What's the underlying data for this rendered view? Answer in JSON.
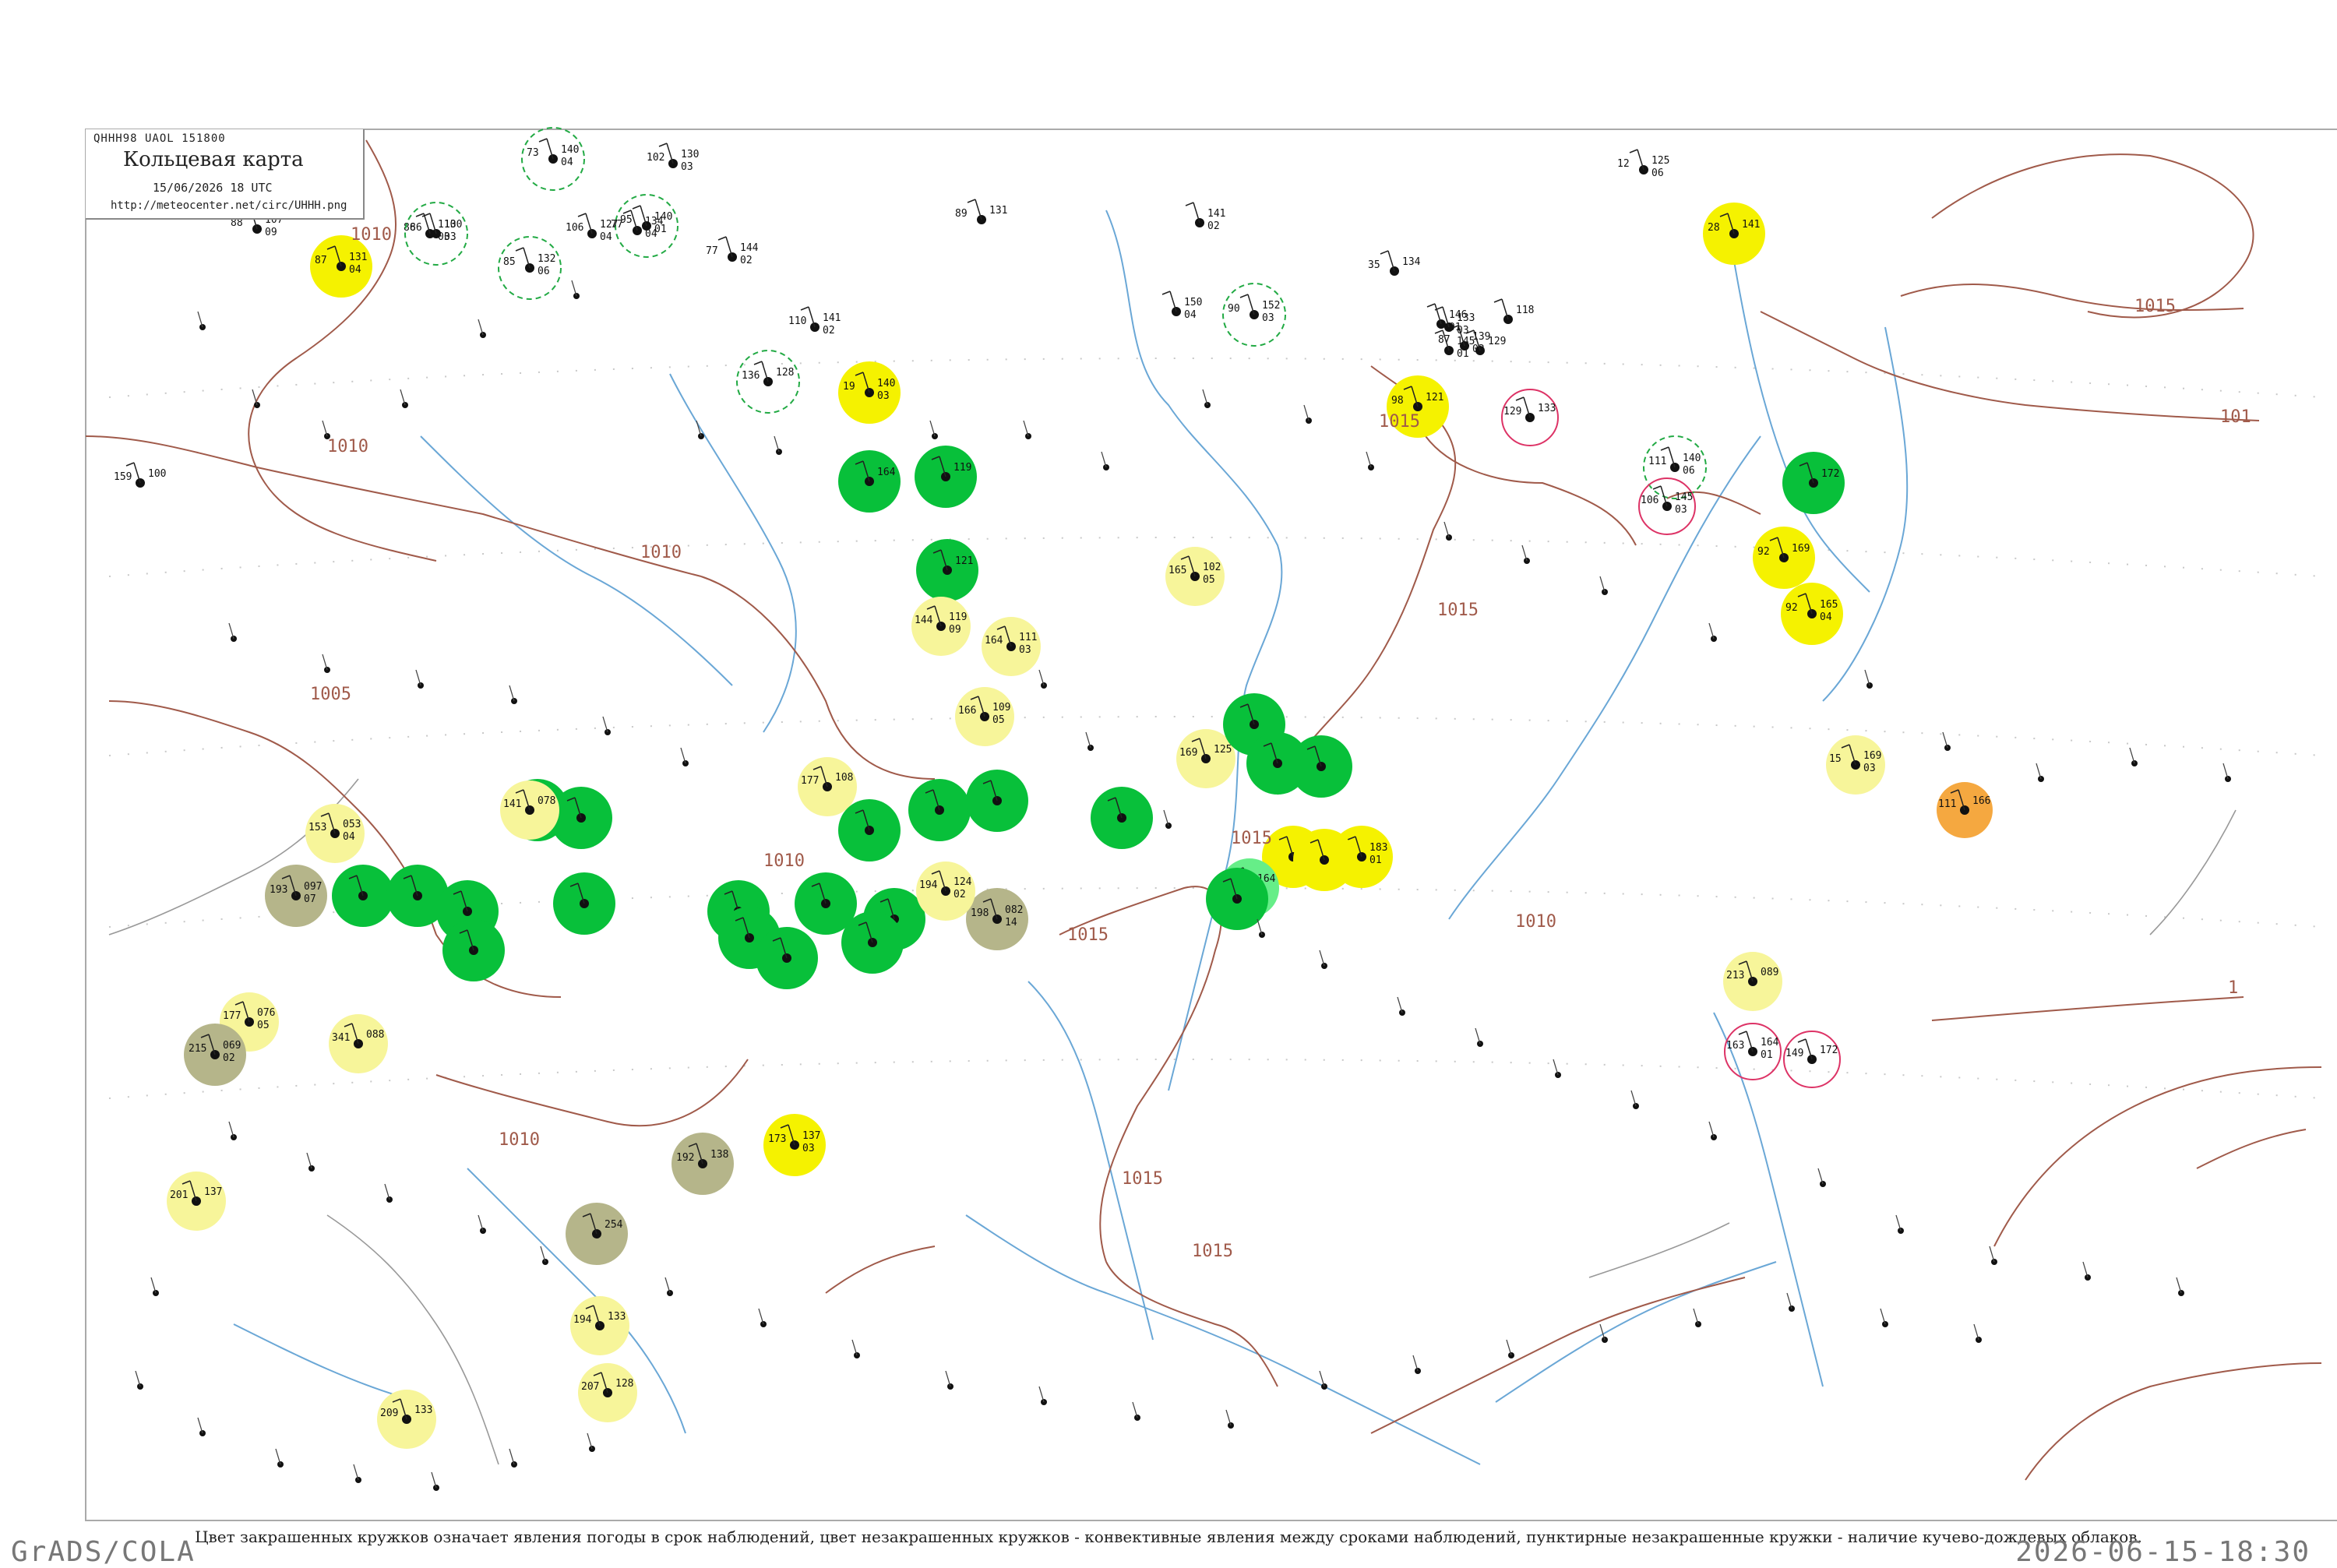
{
  "header": {
    "code_line": "QHHH98  UAOL  151800",
    "title": "Кольцевая карта",
    "date_line": "15/06/2026 18 UTC",
    "url": "http://meteocenter.net/circ/UHHH.png"
  },
  "caption": "Цвет закрашенных кружков означает явления погоды в срок наблюдений, цвет незакрашенных кружков - конвективные явления между сроками наблюдений, пунктирные незакрашенные кружки - наличие кучево-дождевых облаков.",
  "footer": {
    "left": "GrADS/COLA",
    "right": "2026-06-15-18:30"
  },
  "colors": {
    "isobar": "#a05a4a",
    "river": "#6aa7d6",
    "border": "#999999",
    "green": "#08c03a",
    "light_green": "#66ee88",
    "yellow": "#f5f200",
    "light_yellow": "#f7f59a",
    "olive": "#b5b58a",
    "orange": "#f5a840",
    "ring_green": "#22aa44",
    "ring_red": "#dd3366"
  },
  "isobar_labels": [
    {
      "text": "1010"
    },
    {
      "text": "1010"
    },
    {
      "text": "1010"
    },
    {
      "text": "1005"
    },
    {
      "text": "1010"
    },
    {
      "text": "1010"
    },
    {
      "text": "1015"
    },
    {
      "text": "1015"
    },
    {
      "text": "1015"
    },
    {
      "text": "1015"
    },
    {
      "text": "1015"
    },
    {
      "text": "1015"
    },
    {
      "text": "1010"
    },
    {
      "text": "1015"
    },
    {
      "text": "101"
    },
    {
      "text": "1"
    }
  ],
  "stations": [
    {
      "t": "131",
      "p": "04",
      "d": "87",
      "c": "yellow"
    },
    {
      "t": "107",
      "p": "09",
      "d": "88",
      "c": "none"
    },
    {
      "t": "110",
      "p": "03",
      "d": "86",
      "c": "none"
    },
    {
      "t": "140",
      "p": "04",
      "d": "73",
      "c": "ring_green"
    },
    {
      "t": "130",
      "p": "03",
      "d": "102",
      "c": "none"
    },
    {
      "t": "134",
      "p": "04",
      "d": "77",
      "c": "none"
    },
    {
      "t": "140",
      "p": "01",
      "d": "95",
      "c": "ring_green"
    },
    {
      "t": "132",
      "p": "06",
      "d": "85",
      "c": "ring_green"
    },
    {
      "t": "127",
      "p": "04",
      "d": "106",
      "c": "none"
    },
    {
      "t": "130",
      "p": "03",
      "d": "86",
      "c": "ring_green"
    },
    {
      "t": "144",
      "p": "02",
      "d": "77",
      "c": "none"
    },
    {
      "t": "131",
      "p": "",
      "d": "89",
      "c": "none"
    },
    {
      "t": "141",
      "p": "02",
      "d": "",
      "c": "none"
    },
    {
      "t": "125",
      "p": "06",
      "d": "12",
      "c": "none"
    },
    {
      "t": "141",
      "p": "",
      "d": "28",
      "c": "yellow"
    },
    {
      "t": "150",
      "p": "04",
      "d": "",
      "c": "none"
    },
    {
      "t": "152",
      "p": "03",
      "d": "90",
      "c": "ring_green"
    },
    {
      "t": "134",
      "p": "",
      "d": "35",
      "c": "none"
    },
    {
      "t": "146",
      "p": "01",
      "d": "",
      "c": "none"
    },
    {
      "t": "139",
      "p": "02",
      "d": "87",
      "c": "none"
    },
    {
      "t": "118",
      "p": "",
      "d": "",
      "c": "none"
    },
    {
      "t": "141",
      "p": "02",
      "d": "110",
      "c": "none"
    },
    {
      "t": "128",
      "p": "",
      "d": "136",
      "c": "ring_green"
    },
    {
      "t": "140",
      "p": "03",
      "d": "19",
      "c": "yellow"
    },
    {
      "t": "133",
      "p": "03",
      "d": "",
      "c": "none"
    },
    {
      "t": "145",
      "p": "01",
      "d": "",
      "c": "none"
    },
    {
      "t": "129",
      "p": "",
      "d": "",
      "c": "none"
    },
    {
      "t": "121",
      "p": "",
      "d": "98",
      "c": "yellow"
    },
    {
      "t": "133",
      "p": "",
      "d": "129",
      "c": "ring_red"
    },
    {
      "t": "140",
      "p": "06",
      "d": "111",
      "c": "ring_green"
    },
    {
      "t": "145",
      "p": "03",
      "d": "106",
      "c": "ring_red"
    },
    {
      "t": "164",
      "p": "",
      "d": "",
      "c": "green"
    },
    {
      "t": "100",
      "p": "",
      "d": "159",
      "c": "none"
    },
    {
      "t": "119",
      "p": "",
      "d": "",
      "c": "green"
    },
    {
      "t": "121",
      "p": "",
      "d": "",
      "c": "green"
    },
    {
      "t": "119",
      "p": "09",
      "d": "144",
      "c": "light_yellow"
    },
    {
      "t": "111",
      "p": "03",
      "d": "164",
      "c": "light_yellow"
    },
    {
      "t": "102",
      "p": "05",
      "d": "165",
      "c": "light_yellow"
    },
    {
      "t": "172",
      "p": "",
      "d": "",
      "c": "green"
    },
    {
      "t": "169",
      "p": "",
      "d": "92",
      "c": "yellow"
    },
    {
      "t": "165",
      "p": "04",
      "d": "92",
      "c": "yellow"
    },
    {
      "t": "109",
      "p": "05",
      "d": "166",
      "c": "light_yellow"
    },
    {
      "t": "125",
      "p": "",
      "d": "169",
      "c": "light_yellow"
    },
    {
      "t": "",
      "p": "",
      "d": "",
      "c": "green"
    },
    {
      "t": "",
      "p": "",
      "d": "",
      "c": "green"
    },
    {
      "t": "",
      "p": "",
      "d": "",
      "c": "green"
    },
    {
      "t": "169",
      "p": "03",
      "d": "15",
      "c": "light_yellow"
    },
    {
      "t": "166",
      "p": "",
      "d": "111",
      "c": "orange"
    },
    {
      "t": "",
      "p": "",
      "d": "",
      "c": "green"
    },
    {
      "t": "108",
      "p": "",
      "d": "177",
      "c": "light_yellow"
    },
    {
      "t": "",
      "p": "",
      "d": "",
      "c": "green"
    },
    {
      "t": "",
      "p": "",
      "d": "",
      "c": "green"
    },
    {
      "t": "",
      "p": "",
      "d": "",
      "c": "green"
    },
    {
      "t": "",
      "p": "",
      "d": "",
      "c": "green"
    },
    {
      "t": "",
      "p": "",
      "d": "",
      "c": "green"
    },
    {
      "t": "078",
      "p": "",
      "d": "141",
      "c": "light_yellow"
    },
    {
      "t": "053",
      "p": "04",
      "d": "153",
      "c": "light_yellow"
    },
    {
      "t": "",
      "p": "",
      "d": "",
      "c": "green"
    },
    {
      "t": "",
      "p": "",
      "d": "",
      "c": "green"
    },
    {
      "t": "082",
      "p": "14",
      "d": "198",
      "c": "olive"
    },
    {
      "t": "097",
      "p": "07",
      "d": "193",
      "c": "olive"
    },
    {
      "t": "",
      "p": "",
      "d": "",
      "c": "green"
    },
    {
      "t": "",
      "p": "",
      "d": "",
      "c": "green"
    },
    {
      "t": "",
      "p": "",
      "d": "",
      "c": "green"
    },
    {
      "t": "",
      "p": "",
      "d": "",
      "c": "green"
    },
    {
      "t": "124",
      "p": "02",
      "d": "194",
      "c": "light_yellow"
    },
    {
      "t": "",
      "p": "",
      "d": "",
      "c": "green"
    },
    {
      "t": "",
      "p": "",
      "d": "",
      "c": "green"
    },
    {
      "t": "",
      "p": "",
      "d": "",
      "c": "green"
    },
    {
      "t": "",
      "p": "",
      "d": "",
      "c": "green"
    },
    {
      "t": "",
      "p": "",
      "d": "",
      "c": "green"
    },
    {
      "t": "183",
      "p": "01",
      "d": "116",
      "c": "yellow"
    },
    {
      "t": "",
      "p": "",
      "d": "",
      "c": "yellow"
    },
    {
      "t": "",
      "p": "",
      "d": "",
      "c": "yellow"
    },
    {
      "t": "164",
      "p": "",
      "d": "",
      "c": "light_green"
    },
    {
      "t": "",
      "p": "",
      "d": "",
      "c": "green"
    },
    {
      "t": "076",
      "p": "05",
      "d": "177",
      "c": "light_yellow"
    },
    {
      "t": "088",
      "p": "",
      "d": "341",
      "c": "light_yellow"
    },
    {
      "t": "069",
      "p": "02",
      "d": "215",
      "c": "olive"
    },
    {
      "t": "137",
      "p": "03",
      "d": "173",
      "c": "yellow"
    },
    {
      "t": "138",
      "p": "",
      "d": "192",
      "c": "olive"
    },
    {
      "t": "137",
      "p": "",
      "d": "201",
      "c": "light_yellow"
    },
    {
      "t": "254",
      "p": "",
      "d": "",
      "c": "olive"
    },
    {
      "t": "133",
      "p": "",
      "d": "194",
      "c": "light_yellow"
    },
    {
      "t": "128",
      "p": "",
      "d": "207",
      "c": "light_yellow"
    },
    {
      "t": "133",
      "p": "",
      "d": "209",
      "c": "light_yellow"
    },
    {
      "t": "089",
      "p": "",
      "d": "213",
      "c": "light_yellow"
    },
    {
      "t": "164",
      "p": "01",
      "d": "163",
      "c": "ring_red"
    },
    {
      "t": "172",
      "p": "",
      "d": "149",
      "c": "ring_red"
    },
    {
      "t": "",
      "p": "",
      "d": "",
      "c": "ring_red"
    }
  ]
}
